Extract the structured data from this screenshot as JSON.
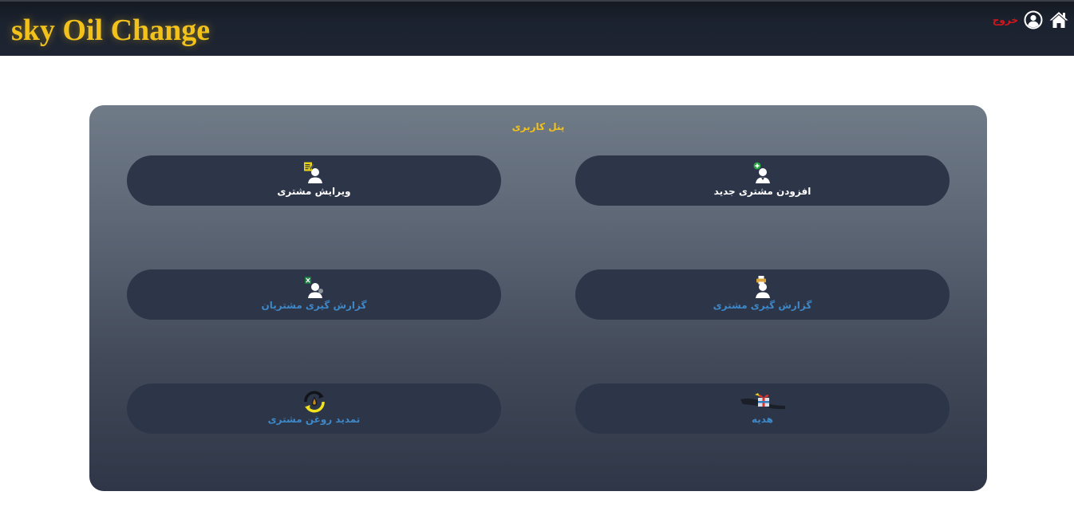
{
  "header": {
    "brand": "sky Oil Change",
    "logout_label": "خروج",
    "icons": [
      "home-icon",
      "user-circle-icon"
    ]
  },
  "panel": {
    "title": "پنل کاربری",
    "tiles": [
      {
        "label": "افزودن مشتری جدید",
        "icon": "add-user-icon"
      },
      {
        "label": "ویرایش مشتری",
        "icon": "edit-user-icon"
      },
      {
        "label": "گزارش گیری مشتری",
        "icon": "printer-user-icon"
      },
      {
        "label": "گزارش گیری مشتریان",
        "icon": "excel-user-icon"
      },
      {
        "label": "هدیه",
        "icon": "gift-hand-icon"
      },
      {
        "label": "تمدید روغن مشتری",
        "icon": "oil-renew-icon"
      }
    ]
  },
  "colors": {
    "brand": "#f2c21b",
    "logout": "#d4161c",
    "tile_bg": "#2d3548",
    "label_active": "#ffffff",
    "label_link": "#3e88c7"
  }
}
